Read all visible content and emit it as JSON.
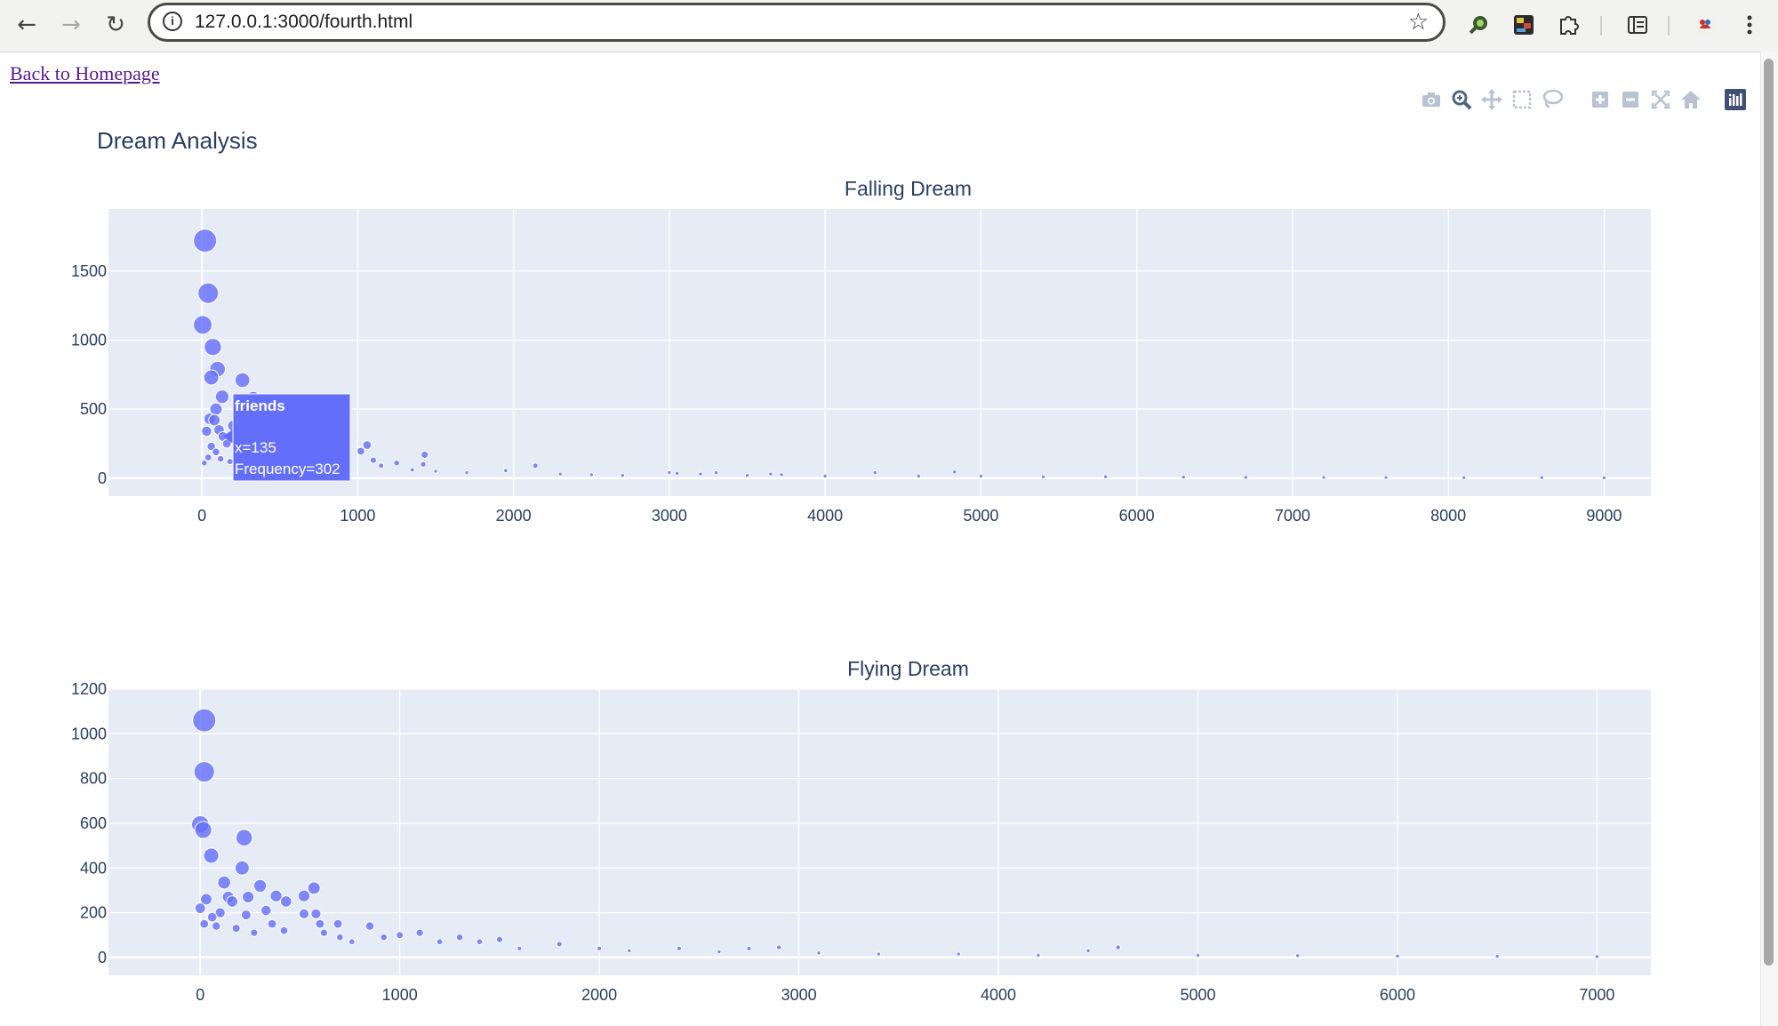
{
  "browser": {
    "back_icon": "arrow-left-icon",
    "forward_icon": "arrow-right-icon",
    "reload_icon": "reload-icon",
    "url": "127.0.0.1:3000/fourth.html",
    "extensions": [
      "search-extension-icon",
      "media-extension-icon",
      "puzzle-extension-icon",
      "side-panel-icon",
      "profile-avatar-icon",
      "menu-kebab-icon"
    ]
  },
  "page": {
    "back_link": "Back to Homepage",
    "title": "Dream Analysis"
  },
  "modebar": [
    "camera-icon",
    "zoom-icon",
    "pan-icon",
    "box-select-icon",
    "lasso-select-icon",
    "zoom-in-icon",
    "zoom-out-icon",
    "autoscale-icon",
    "reset-axes-icon",
    "plotly-logo-icon"
  ],
  "tooltip": {
    "name": "friends",
    "x_text": "x=135",
    "y_text": "Frequency=302"
  },
  "colors": {
    "marker": "#636efa",
    "plot_bg": "#e5ecf6",
    "axis_text": "#2a3f5f"
  },
  "chart_data": [
    {
      "type": "scatter",
      "title": "Falling Dream",
      "xlabel": "",
      "ylabel": "",
      "xlim": [
        -600,
        9300
      ],
      "ylim": [
        -130,
        1950
      ],
      "x_ticks": [
        "0",
        "1000",
        "2000",
        "3000",
        "4000",
        "5000",
        "6000",
        "7000",
        "8000",
        "9000"
      ],
      "y_ticks": [
        "0",
        "500",
        "1000",
        "1500"
      ],
      "grid": true,
      "marker_size_by": "Frequency",
      "points": [
        {
          "x": 20,
          "y": 1720
        },
        {
          "x": 40,
          "y": 1340
        },
        {
          "x": 5,
          "y": 1110
        },
        {
          "x": 70,
          "y": 950
        },
        {
          "x": 100,
          "y": 790
        },
        {
          "x": 60,
          "y": 730
        },
        {
          "x": 260,
          "y": 710
        },
        {
          "x": 130,
          "y": 590
        },
        {
          "x": 330,
          "y": 580
        },
        {
          "x": 90,
          "y": 500
        },
        {
          "x": 50,
          "y": 430
        },
        {
          "x": 80,
          "y": 420
        },
        {
          "x": 30,
          "y": 340
        },
        {
          "x": 110,
          "y": 350
        },
        {
          "x": 135,
          "y": 302
        },
        {
          "x": 200,
          "y": 380
        },
        {
          "x": 160,
          "y": 250
        },
        {
          "x": 60,
          "y": 230
        },
        {
          "x": 90,
          "y": 190
        },
        {
          "x": 40,
          "y": 150
        },
        {
          "x": 120,
          "y": 140
        },
        {
          "x": 180,
          "y": 120
        },
        {
          "x": 230,
          "y": 100
        },
        {
          "x": 15,
          "y": 110
        },
        {
          "x": 280,
          "y": 90
        },
        {
          "x": 350,
          "y": 70
        },
        {
          "x": 420,
          "y": 60
        },
        {
          "x": 500,
          "y": 50
        },
        {
          "x": 600,
          "y": 40
        },
        {
          "x": 700,
          "y": 30
        },
        {
          "x": 800,
          "y": 25
        },
        {
          "x": 900,
          "y": 20
        },
        {
          "x": 1060,
          "y": 240
        },
        {
          "x": 1020,
          "y": 195
        },
        {
          "x": 1100,
          "y": 130
        },
        {
          "x": 1250,
          "y": 110
        },
        {
          "x": 1430,
          "y": 170
        },
        {
          "x": 1420,
          "y": 100
        },
        {
          "x": 1150,
          "y": 90
        },
        {
          "x": 1350,
          "y": 60
        },
        {
          "x": 1500,
          "y": 50
        },
        {
          "x": 1700,
          "y": 40
        },
        {
          "x": 2140,
          "y": 90
        },
        {
          "x": 1950,
          "y": 55
        },
        {
          "x": 2300,
          "y": 30
        },
        {
          "x": 2500,
          "y": 25
        },
        {
          "x": 2700,
          "y": 20
        },
        {
          "x": 3000,
          "y": 40
        },
        {
          "x": 3050,
          "y": 35
        },
        {
          "x": 3200,
          "y": 30
        },
        {
          "x": 3300,
          "y": 40
        },
        {
          "x": 3500,
          "y": 20
        },
        {
          "x": 3650,
          "y": 30
        },
        {
          "x": 3720,
          "y": 25
        },
        {
          "x": 4000,
          "y": 15
        },
        {
          "x": 4320,
          "y": 40
        },
        {
          "x": 4600,
          "y": 15
        },
        {
          "x": 4830,
          "y": 45
        },
        {
          "x": 5000,
          "y": 15
        },
        {
          "x": 5400,
          "y": 10
        },
        {
          "x": 5800,
          "y": 10
        },
        {
          "x": 6300,
          "y": 8
        },
        {
          "x": 6700,
          "y": 6
        },
        {
          "x": 7200,
          "y": 5
        },
        {
          "x": 7600,
          "y": 5
        },
        {
          "x": 8100,
          "y": 4
        },
        {
          "x": 8600,
          "y": 4
        },
        {
          "x": 9000,
          "y": 3
        }
      ]
    },
    {
      "type": "scatter",
      "title": "Flying Dream",
      "xlabel": "",
      "ylabel": "",
      "xlim": [
        -460,
        7270
      ],
      "ylim": [
        -80,
        1200
      ],
      "x_ticks": [
        "0",
        "1000",
        "2000",
        "3000",
        "4000",
        "5000",
        "6000",
        "7000"
      ],
      "y_ticks": [
        "0",
        "200",
        "400",
        "600",
        "800",
        "1000",
        "1200"
      ],
      "grid": true,
      "marker_size_by": "Frequency",
      "points": [
        {
          "x": 20,
          "y": 1060
        },
        {
          "x": 20,
          "y": 830
        },
        {
          "x": 0,
          "y": 595
        },
        {
          "x": 15,
          "y": 570
        },
        {
          "x": 220,
          "y": 535
        },
        {
          "x": 55,
          "y": 455
        },
        {
          "x": 210,
          "y": 400
        },
        {
          "x": 570,
          "y": 310
        },
        {
          "x": 120,
          "y": 335
        },
        {
          "x": 300,
          "y": 320
        },
        {
          "x": 520,
          "y": 275
        },
        {
          "x": 380,
          "y": 275
        },
        {
          "x": 240,
          "y": 270
        },
        {
          "x": 430,
          "y": 250
        },
        {
          "x": 140,
          "y": 270
        },
        {
          "x": 160,
          "y": 250
        },
        {
          "x": 30,
          "y": 260
        },
        {
          "x": 0,
          "y": 220
        },
        {
          "x": 330,
          "y": 210
        },
        {
          "x": 520,
          "y": 195
        },
        {
          "x": 580,
          "y": 195
        },
        {
          "x": 100,
          "y": 200
        },
        {
          "x": 60,
          "y": 180
        },
        {
          "x": 230,
          "y": 190
        },
        {
          "x": 20,
          "y": 150
        },
        {
          "x": 80,
          "y": 140
        },
        {
          "x": 180,
          "y": 130
        },
        {
          "x": 270,
          "y": 110
        },
        {
          "x": 360,
          "y": 150
        },
        {
          "x": 420,
          "y": 120
        },
        {
          "x": 600,
          "y": 150
        },
        {
          "x": 690,
          "y": 150
        },
        {
          "x": 620,
          "y": 110
        },
        {
          "x": 700,
          "y": 90
        },
        {
          "x": 760,
          "y": 70
        },
        {
          "x": 850,
          "y": 140
        },
        {
          "x": 920,
          "y": 90
        },
        {
          "x": 1000,
          "y": 100
        },
        {
          "x": 1100,
          "y": 110
        },
        {
          "x": 1200,
          "y": 70
        },
        {
          "x": 1300,
          "y": 90
        },
        {
          "x": 1400,
          "y": 70
        },
        {
          "x": 1500,
          "y": 80
        },
        {
          "x": 1600,
          "y": 40
        },
        {
          "x": 1800,
          "y": 60
        },
        {
          "x": 2000,
          "y": 40
        },
        {
          "x": 2150,
          "y": 30
        },
        {
          "x": 2400,
          "y": 40
        },
        {
          "x": 2600,
          "y": 25
        },
        {
          "x": 2750,
          "y": 40
        },
        {
          "x": 2900,
          "y": 45
        },
        {
          "x": 3100,
          "y": 20
        },
        {
          "x": 3400,
          "y": 15
        },
        {
          "x": 3800,
          "y": 15
        },
        {
          "x": 4200,
          "y": 10
        },
        {
          "x": 4450,
          "y": 30
        },
        {
          "x": 4600,
          "y": 45
        },
        {
          "x": 5000,
          "y": 10
        },
        {
          "x": 5500,
          "y": 8
        },
        {
          "x": 6000,
          "y": 6
        },
        {
          "x": 6500,
          "y": 5
        },
        {
          "x": 7000,
          "y": 4
        }
      ]
    }
  ]
}
